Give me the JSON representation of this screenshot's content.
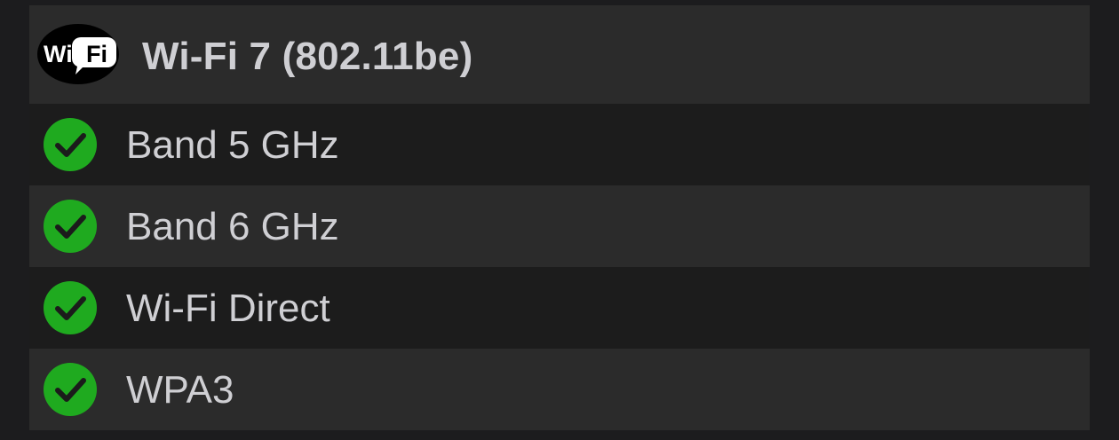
{
  "header": {
    "logo_icon": "wifi-logo-icon",
    "logo_text_left": "Wi",
    "logo_text_right": "Fi",
    "title": "Wi-Fi 7 (802.11be)"
  },
  "features": [
    {
      "label": "Band 5 GHz",
      "supported": true,
      "icon": "check-circle-icon"
    },
    {
      "label": "Band 6 GHz",
      "supported": true,
      "icon": "check-circle-icon"
    },
    {
      "label": "Wi-Fi Direct",
      "supported": true,
      "icon": "check-circle-icon"
    },
    {
      "label": "WPA3",
      "supported": true,
      "icon": "check-circle-icon"
    }
  ],
  "colors": {
    "check_fill": "#1faa1f",
    "check_mark": "#1b1b1b",
    "text": "#cfcfd3",
    "background": "#1c1c1e"
  }
}
